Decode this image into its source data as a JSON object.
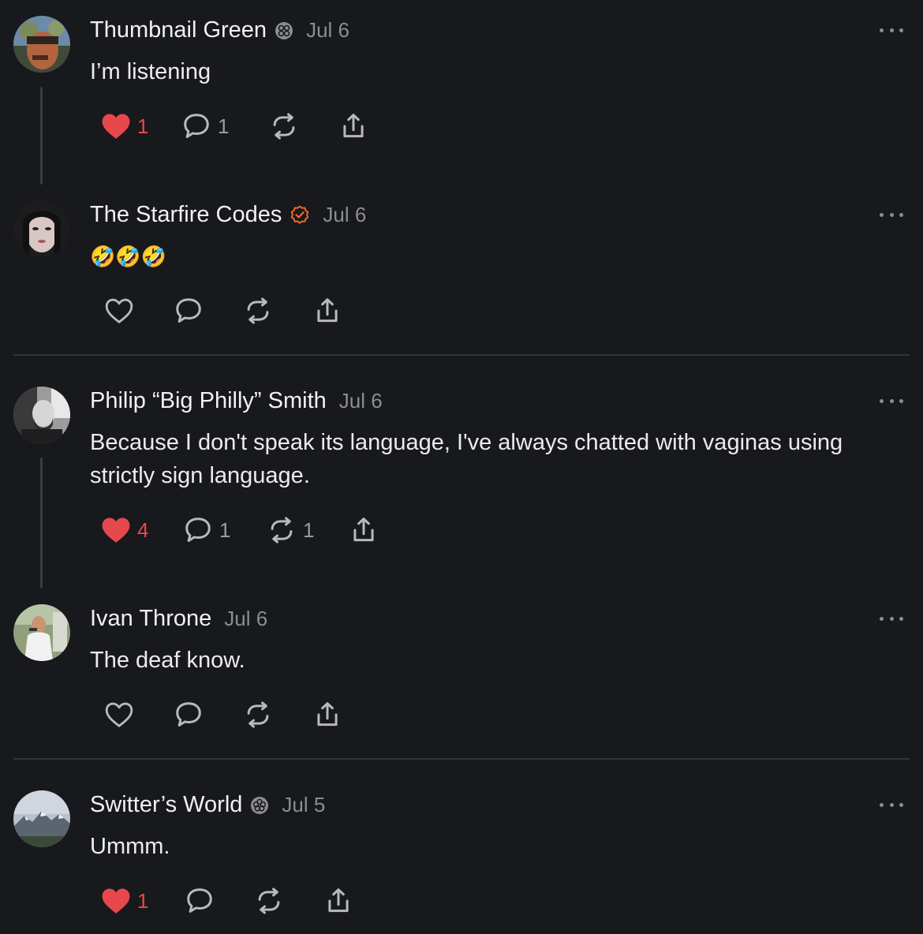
{
  "posts": [
    {
      "author": "Thumbnail Green",
      "badge": "flower-badge",
      "date": "Jul 6",
      "text": "I’m listening",
      "likes": "1",
      "liked": true,
      "replies": "1",
      "reposts": ""
    },
    {
      "author": "The Starfire Codes",
      "badge": "orange-verified-badge",
      "date": "Jul 6",
      "text": "🤣🤣🤣",
      "likes": "",
      "liked": false,
      "replies": "",
      "reposts": ""
    },
    {
      "author": "Philip “Big Philly” Smith",
      "badge": "",
      "date": "Jul 6",
      "text": "Because I don't speak its language, I've always chatted with vaginas using strictly sign language.",
      "likes": "4",
      "liked": true,
      "replies": "1",
      "reposts": "1"
    },
    {
      "author": "Ivan Throne",
      "badge": "",
      "date": "Jul 6",
      "text": "The deaf know.",
      "likes": "",
      "liked": false,
      "replies": "",
      "reposts": ""
    },
    {
      "author": "Switter’s World",
      "badge": "flower-badge",
      "date": "Jul 5",
      "text": "Ummm.",
      "likes": "1",
      "liked": true,
      "replies": "",
      "reposts": ""
    }
  ],
  "colors": {
    "background": "#18191c",
    "like_red": "#e6484d",
    "verified_orange": "#f26b2a",
    "muted": "#8c8d92"
  }
}
